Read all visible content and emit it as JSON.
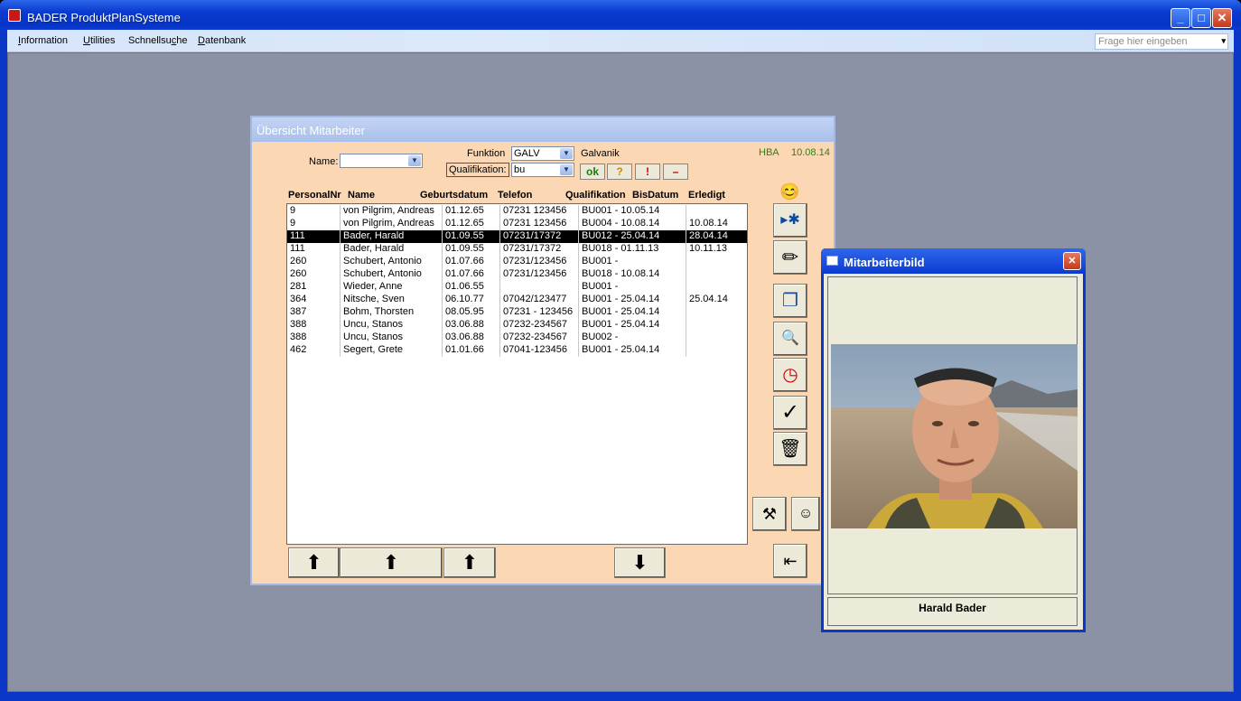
{
  "window": {
    "title": "BADER ProduktPlanSysteme",
    "min": "_",
    "max": "□",
    "close": "✕"
  },
  "menu": {
    "items": [
      {
        "pre": "",
        "u": "I",
        "post": "nformation"
      },
      {
        "pre": "",
        "u": "U",
        "post": "tilities"
      },
      {
        "pre": "Schnellsu",
        "u": "c",
        "post": "he"
      },
      {
        "pre": "",
        "u": "D",
        "post": "atenbank"
      }
    ],
    "help_placeholder": "Frage hier eingeben"
  },
  "employee_form": {
    "title": "Übersicht Mitarbeiter",
    "name_label": "Name:",
    "name_value": "",
    "funktion_label": "Funktion",
    "funktion_value": "GALV",
    "funktion_desc": "Galvanik",
    "qualifikation_label": "Qualifikation:",
    "qualifikation_value": "bu",
    "user": "HBA",
    "date": "10.08.14",
    "btn_ok": "ok",
    "btn_q": "?",
    "btn_ex": "!",
    "btn_minus": "–",
    "columns": [
      "PersonalNr",
      "Name",
      "Geburtsdatum",
      "Telefon",
      "Qualifikation",
      "BisDatum",
      "Erledigt"
    ],
    "rows": [
      [
        "9",
        "von Pilgrim, Andreas",
        "01.12.65",
        "07231 123456",
        "BU001 - 10.05.14",
        ""
      ],
      [
        "9",
        "von Pilgrim, Andreas",
        "01.12.65",
        "07231 123456",
        "BU004 - 10.08.14",
        "10.08.14"
      ],
      [
        "111",
        "Bader, Harald",
        "01.09.55",
        "07231/17372",
        "BU012 - 25.04.14",
        "28.04.14"
      ],
      [
        "111",
        "Bader, Harald",
        "01.09.55",
        "07231/17372",
        "BU018 - 01.11.13",
        "10.11.13"
      ],
      [
        "260",
        "Schubert, Antonio",
        "01.07.66",
        "07231/123456",
        "BU001 -",
        ""
      ],
      [
        "260",
        "Schubert, Antonio",
        "01.07.66",
        "07231/123456",
        "BU018 - 10.08.14",
        ""
      ],
      [
        "281",
        "Wieder, Anne",
        "01.06.55",
        "",
        "BU001 -",
        ""
      ],
      [
        "364",
        "Nitsche, Sven",
        "06.10.77",
        "07042/123477",
        "BU001 - 25.04.14",
        "25.04.14"
      ],
      [
        "387",
        "Bohm, Thorsten",
        "08.05.95",
        "07231 - 123456",
        "BU001 - 25.04.14",
        ""
      ],
      [
        "388",
        "Uncu, Stanos",
        "03.06.88",
        "07232-234567",
        "BU001 - 25.04.14",
        ""
      ],
      [
        "388",
        "Uncu, Stanos",
        "03.06.88",
        "07232-234567",
        "BU002 -",
        ""
      ],
      [
        "462",
        "Segert, Grete",
        "01.01.66",
        "07041-123456",
        "BU001 - 25.04.14",
        ""
      ]
    ],
    "selected_row": 2
  },
  "image_dialog": {
    "title": "Mitarbeiterbild",
    "caption": "Harald Bader"
  },
  "colors": {
    "form_bg": "#fcd7b4",
    "title_blue": "#0a3ad0",
    "status_green": "#2e7d1a"
  }
}
